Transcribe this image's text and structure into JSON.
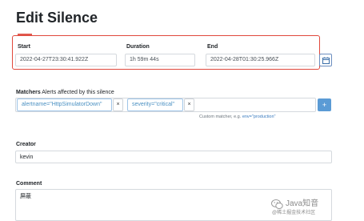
{
  "page": {
    "title": "Edit Silence"
  },
  "fields": {
    "start": {
      "label": "Start",
      "value": "2022-04-27T23:30:41.922Z"
    },
    "duration": {
      "label": "Duration",
      "value": "1h 59m 44s"
    },
    "end": {
      "label": "End",
      "value": "2022-04-28T01:30:25.966Z"
    }
  },
  "matchers": {
    "label": "Matchers",
    "description": "Alerts affected by this silence",
    "items": [
      {
        "text": "alertname=\"HttpSimulatorDown\"",
        "remove": "×"
      },
      {
        "text": "severity=\"critical\"",
        "remove": "×"
      }
    ],
    "add_label": "+",
    "hint_prefix": "Custom matcher, e.g.",
    "hint_example": "env=\"production\""
  },
  "creator": {
    "label": "Creator",
    "value": "kevin"
  },
  "comment": {
    "label": "Comment",
    "value": "屏蔽"
  },
  "watermark": {
    "text": "Java知音",
    "subtext": "@稀土掘金技术社区"
  },
  "colors": {
    "highlight": "#e0483c",
    "accent": "#4a90c2",
    "button": "#5b9bd5"
  },
  "icons": {
    "calendar": "calendar-icon",
    "add": "plus-icon",
    "watermark": "wechat-icon"
  }
}
